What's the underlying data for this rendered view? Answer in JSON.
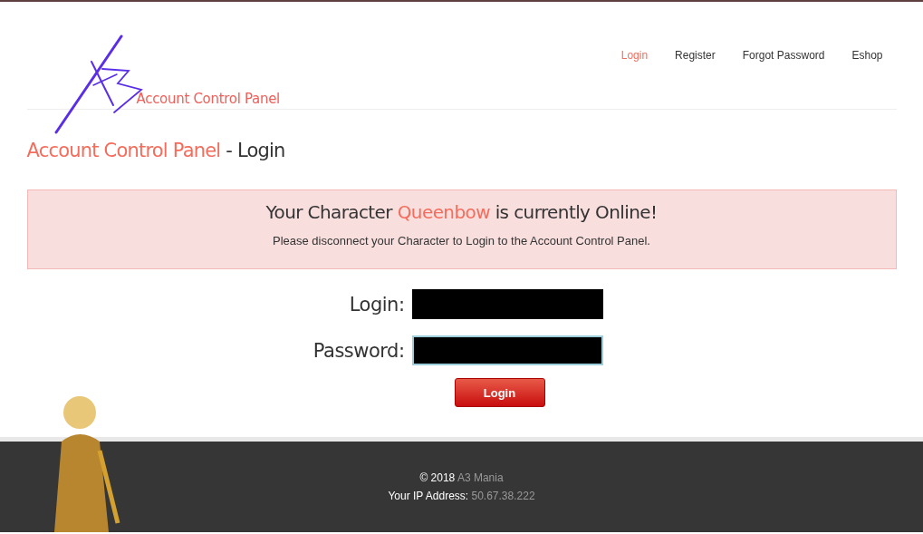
{
  "logo": {
    "text": "Account Control Panel"
  },
  "nav": [
    {
      "label": "Login",
      "selected": true
    },
    {
      "label": "Register",
      "selected": false
    },
    {
      "label": "Forgot Password",
      "selected": false
    },
    {
      "label": "Eshop",
      "selected": false
    }
  ],
  "heading": {
    "site": "Account Control Panel",
    "separator": " - ",
    "page": "Login"
  },
  "alert": {
    "prefix": "Your Character ",
    "name": "Queenbow",
    "suffix": " is currently Online!",
    "message": "Please disconnect your Character to Login to the Account Control Panel."
  },
  "form": {
    "fields": [
      {
        "label": "Login:",
        "focused": false
      },
      {
        "label": "Password:",
        "focused": true
      }
    ],
    "button": "Login"
  },
  "footer": {
    "copyright": "© 2018",
    "site": "A3 Mania",
    "ip_label": "Your IP Address:",
    "ip": "50.67.38.222"
  }
}
